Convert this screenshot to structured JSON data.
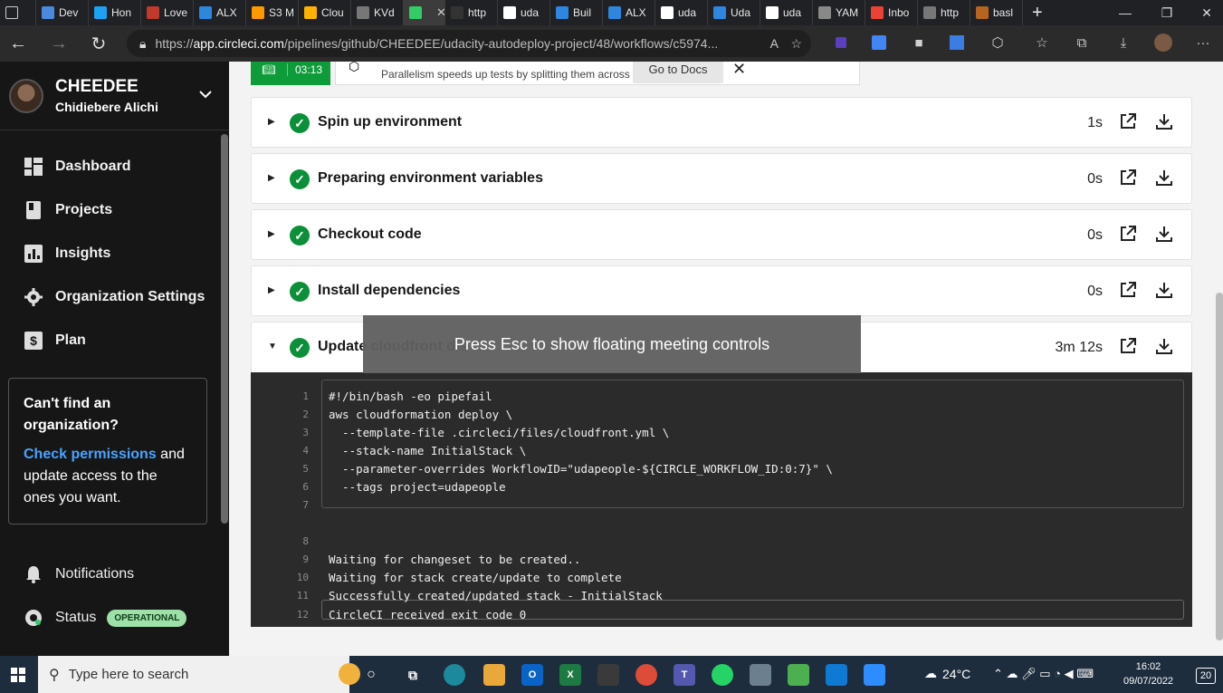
{
  "browser": {
    "tabs": [
      {
        "label": "Dev",
        "fav": "#4a89dc"
      },
      {
        "label": "Hon",
        "fav": "#1da1f2"
      },
      {
        "label": "Love",
        "fav": "#c0392b"
      },
      {
        "label": "ALX",
        "fav": "#2e86de"
      },
      {
        "label": "S3 M",
        "fav": "#ff9900"
      },
      {
        "label": "Clou",
        "fav": "#ffb300"
      },
      {
        "label": "KVd",
        "fav": "#777777"
      },
      {
        "label": "",
        "fav": "#33cc66"
      },
      {
        "label": "http",
        "fav": "#333333"
      },
      {
        "label": "uda",
        "fav": "#ffffff"
      },
      {
        "label": "Buil",
        "fav": "#2e86de"
      },
      {
        "label": "ALX",
        "fav": "#2e86de"
      },
      {
        "label": "uda",
        "fav": "#ffffff"
      },
      {
        "label": "Uda",
        "fav": "#2e86de"
      },
      {
        "label": "uda",
        "fav": "#ffffff"
      },
      {
        "label": "YAM",
        "fav": "#888888"
      },
      {
        "label": "Inbo",
        "fav": "#ea4335"
      },
      {
        "label": "http",
        "fav": "#777777"
      },
      {
        "label": "basl",
        "fav": "#b5651d"
      }
    ],
    "url_prefix": "https://",
    "url_host": "app.circleci.com",
    "url_path": "/pipelines/github/CHEEDEE/udacity-autodeploy-project/48/workflows/c5974..."
  },
  "sidebar": {
    "org_name": "CHEEDEE",
    "user_name": "Chidiebere Alichi",
    "nav": [
      {
        "label": "Dashboard"
      },
      {
        "label": "Projects"
      },
      {
        "label": "Insights"
      },
      {
        "label": "Organization Settings"
      },
      {
        "label": "Plan"
      }
    ],
    "help": {
      "title_line1": "Can't find an",
      "title_line2": "organization?",
      "link": "Check permissions",
      "rest1": " and",
      "rest2": "update access to the",
      "rest3": "ones you want."
    },
    "notifications": "Notifications",
    "status": "Status",
    "status_badge": "OPERATIONAL"
  },
  "banner": {
    "timer": "03:13",
    "text": "Parallelism speeds up tests by splitting them across multiple executors.",
    "docs_button": "Go to Docs"
  },
  "steps": [
    {
      "name": "Spin up environment",
      "duration": "1s"
    },
    {
      "name": "Preparing environment variables",
      "duration": "0s"
    },
    {
      "name": "Checkout code",
      "duration": "0s"
    },
    {
      "name": "Install dependencies",
      "duration": "0s"
    },
    {
      "name": "Update cloudfront dis",
      "duration": "3m 12s"
    }
  ],
  "console": {
    "lines": [
      {
        "n": "1",
        "t": "#!/bin/bash -eo pipefail"
      },
      {
        "n": "2",
        "t": "aws cloudformation deploy \\"
      },
      {
        "n": "3",
        "t": "  --template-file .circleci/files/cloudfront.yml \\"
      },
      {
        "n": "4",
        "t": "  --stack-name InitialStack \\"
      },
      {
        "n": "5",
        "t": "  --parameter-overrides WorkflowID=\"udapeople-${CIRCLE_WORKFLOW_ID:0:7}\" \\"
      },
      {
        "n": "6",
        "t": "  --tags project=udapeople"
      },
      {
        "n": "7",
        "t": ""
      },
      {
        "n": "8",
        "t": ""
      },
      {
        "n": "9",
        "t": "Waiting for changeset to be created.."
      },
      {
        "n": "10",
        "t": "Waiting for stack create/update to complete"
      },
      {
        "n": "11",
        "t": "Successfully created/updated stack - InitialStack"
      },
      {
        "n": "12",
        "t": "CircleCI received exit code 0"
      }
    ]
  },
  "toast": "Press Esc to show floating meeting controls",
  "taskbar": {
    "search_placeholder": "Type here to search",
    "weather": "24°C",
    "time": "16:02",
    "date": "09/07/2022",
    "notifications": "20"
  }
}
